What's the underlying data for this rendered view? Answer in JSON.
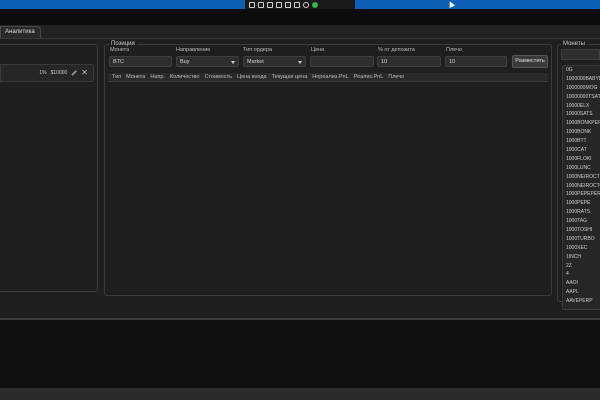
{
  "tab": {
    "label": "Аналитика"
  },
  "left_card": {
    "percent": "1%",
    "amount": "$10000"
  },
  "positions": {
    "title": "Позиции",
    "form": {
      "coin_label": "Монета",
      "coin_value": "BTC",
      "direction_label": "Направление",
      "direction_value": "Buy",
      "order_type_label": "Тип ордера",
      "order_type_value": "Market",
      "price_label": "Цена",
      "price_value": "",
      "deposit_label": "% от депозита",
      "deposit_value": "10",
      "leverage_label": "Плечо",
      "leverage_value": "10",
      "place_button": "Разместить"
    },
    "columns": [
      "Тип",
      "Монета",
      "Напр.",
      "Количество",
      "Стоимость",
      "Цена входа",
      "Текущая цена",
      "Нереализ.PnL",
      "Реализ.PnL",
      "Плечо"
    ]
  },
  "coins": {
    "title": "Монеты",
    "items": [
      "0G",
      "1000000BABYD",
      "1000000MOG",
      "10000000TSAT",
      "10000ELX",
      "10000SATS",
      "1000BONKPERP",
      "1000BONK",
      "1000BTT",
      "1000CAT",
      "1000FLOKI",
      "1000LUNC",
      "1000NEIROCT",
      "1000NEIROCTO",
      "1000PEPEPERP",
      "1000PEPE",
      "1000RATS",
      "1000TAG",
      "1000TOSHI",
      "1000TURBO",
      "1000XEC",
      "1INCH",
      "2Z",
      "4",
      "AAOI",
      "AAPL",
      "AAVEPERP"
    ]
  }
}
